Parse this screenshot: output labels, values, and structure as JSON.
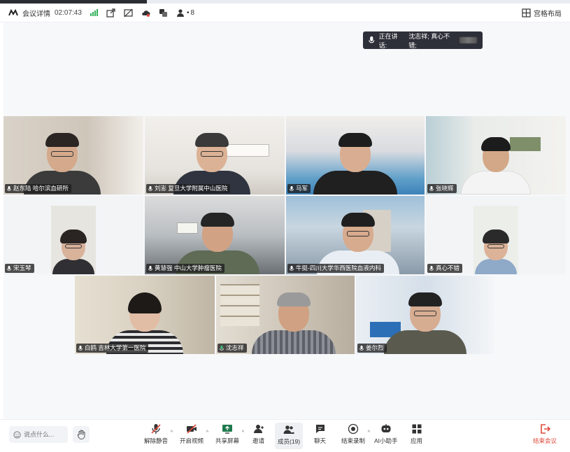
{
  "header": {
    "meeting_info": "会议详情",
    "elapsed": "02:07:43",
    "participants_count": "8",
    "layout_label": "宫格布局"
  },
  "speaking": {
    "label": "正在讲话:",
    "speakers": "沈志祥; 真心不错;"
  },
  "tiles": [
    {
      "name": "赵东陆 哈尔滨血研所",
      "scene": "#cfc7bd",
      "wall": "#e8e3dc",
      "shirt": "#3b3b3b",
      "skin": "#d4a98c"
    },
    {
      "name": "刘澎 复旦大学附属中山医院",
      "scene": "#e9e7e2",
      "wall": "#f4f2ee",
      "shirt": "#2f3440",
      "skin": "#dcb296"
    },
    {
      "name": "马军",
      "scene": "#8fb1c8",
      "wall": "#c7d5de",
      "shirt": "#202020",
      "skin": "#d9ad92"
    },
    {
      "name": "张晓辉",
      "scene": "#e8e6e2",
      "wall": "#f3f2ef",
      "shirt": "#f4f4f4",
      "skin": "#d3a888"
    },
    {
      "name": "宋玉琴",
      "scene": "#f2f3f5",
      "wall": "#ffffff",
      "shirt": "#2f2f34",
      "skin": "#d9b29a"
    },
    {
      "name": "黄慧强 中山大学肿瘤医院",
      "scene": "#a8b0b6",
      "wall": "#d7dadc",
      "shirt": "#5f6b55",
      "skin": "#d1a284"
    },
    {
      "name": "牛挺-四川大学华西医院血液内科",
      "scene": "#9cb9cf",
      "wall": "#c9d7e2",
      "shirt": "#e9eef4",
      "skin": "#d7ab8e"
    },
    {
      "name": "真心不错",
      "scene": "#f2f3f5",
      "wall": "#ffffff",
      "shirt": "#8fa9c9",
      "skin": "#dcb398"
    },
    {
      "name": "白鸥 吉林大学第一医院",
      "scene": "#d9d1c2",
      "wall": "#ebe5d9",
      "shirt": "#3a3a3e",
      "skin": "#e2bda5"
    },
    {
      "name": "沈志祥",
      "scene": "#cdc6ba",
      "wall": "#e4ded3",
      "shirt": "#6d7078",
      "skin": "#d0a182"
    },
    {
      "name": "姜尔烈",
      "scene": "#d5dfe9",
      "wall": "#eef2f6",
      "shirt": "#5a5a4e",
      "skin": "#d7ad92"
    }
  ],
  "toolbar": {
    "chat_placeholder": "说点什么...",
    "unmute": "解除静音",
    "video": "开启视频",
    "share": "共享屏幕",
    "invite": "邀请",
    "members": "成员(19)",
    "chat": "聊天",
    "record": "结束录制",
    "ai": "AI小助手",
    "apps": "应用",
    "end": "结束会议"
  },
  "colors": {
    "accent": "#3fc17a",
    "end": "#e04a3b",
    "signal": "#2fb05a"
  }
}
